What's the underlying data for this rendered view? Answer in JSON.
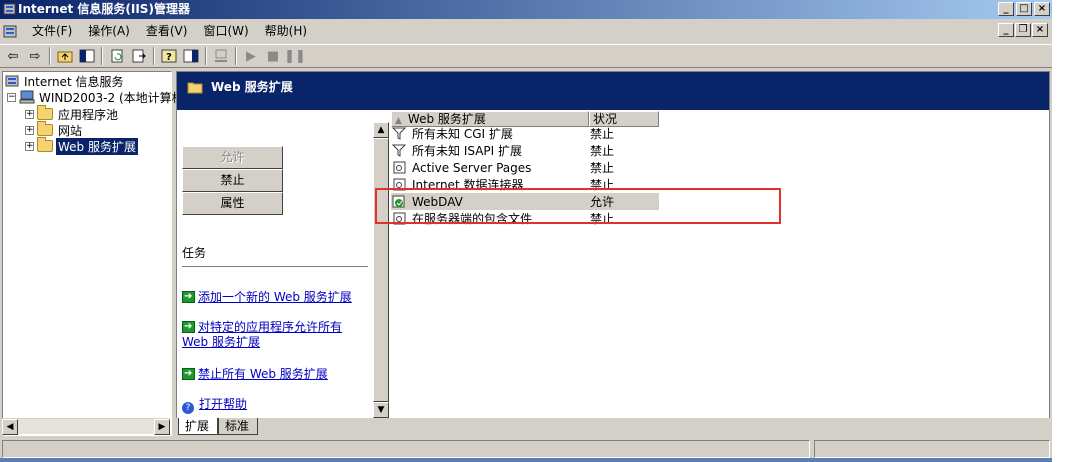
{
  "window": {
    "title": "Internet 信息服务(IIS)管理器",
    "controls": {
      "minimize": "_",
      "maximize": "□",
      "close": "×"
    }
  },
  "menu": {
    "items": [
      "文件(F)",
      "操作(A)",
      "查看(V)",
      "窗口(W)",
      "帮助(H)"
    ],
    "mdi_controls": {
      "minimize": "_",
      "restore": "❐",
      "close": "×"
    }
  },
  "toolbar": {
    "icons": [
      "back-icon",
      "forward-icon",
      "up-folder-icon",
      "show-tree-icon",
      "refresh-icon",
      "export-icon",
      "help-icon",
      "console-icon",
      "computer-icon",
      "play-icon",
      "stop-icon",
      "pause-icon"
    ]
  },
  "tree": {
    "root": "Internet 信息服务",
    "computer": "WIND2003-2 (本地计算机)",
    "children": [
      "应用程序池",
      "网站",
      "Web 服务扩展"
    ],
    "selected": "Web 服务扩展"
  },
  "right_pane": {
    "banner_title": "Web 服务扩展",
    "buttons": {
      "allow": "允许",
      "prohibit": "禁止",
      "properties": "属性"
    },
    "tasks_title": "任务",
    "tasks": [
      "添加一个新的 Web 服务扩展",
      "对特定的应用程序允许所有 Web 服务扩展",
      "禁止所有 Web 服务扩展",
      "打开帮助"
    ]
  },
  "list": {
    "columns": [
      "Web 服务扩展",
      "状况"
    ],
    "rows": [
      {
        "name": "所有未知 CGI 扩展",
        "status": "禁止",
        "icon": "filter-icon"
      },
      {
        "name": "所有未知 ISAPI 扩展",
        "status": "禁止",
        "icon": "filter-icon"
      },
      {
        "name": "Active Server Pages",
        "status": "禁止",
        "icon": "extension-icon"
      },
      {
        "name": "Internet 数据连接器",
        "status": "禁止",
        "icon": "extension-icon"
      },
      {
        "name": "WebDAV",
        "status": "允许",
        "icon": "extension-allowed-icon"
      },
      {
        "name": "在服务器端的包含文件",
        "status": "禁止",
        "icon": "extension-icon"
      }
    ]
  },
  "tabs": [
    "扩展",
    "标准"
  ],
  "colors": {
    "titlebar_start": "#0a246a",
    "titlebar_end": "#a6caf0",
    "banner": "#0a246a",
    "highlight_box": "#e03030",
    "link": "#0000c0",
    "face": "#d4d0c8"
  }
}
